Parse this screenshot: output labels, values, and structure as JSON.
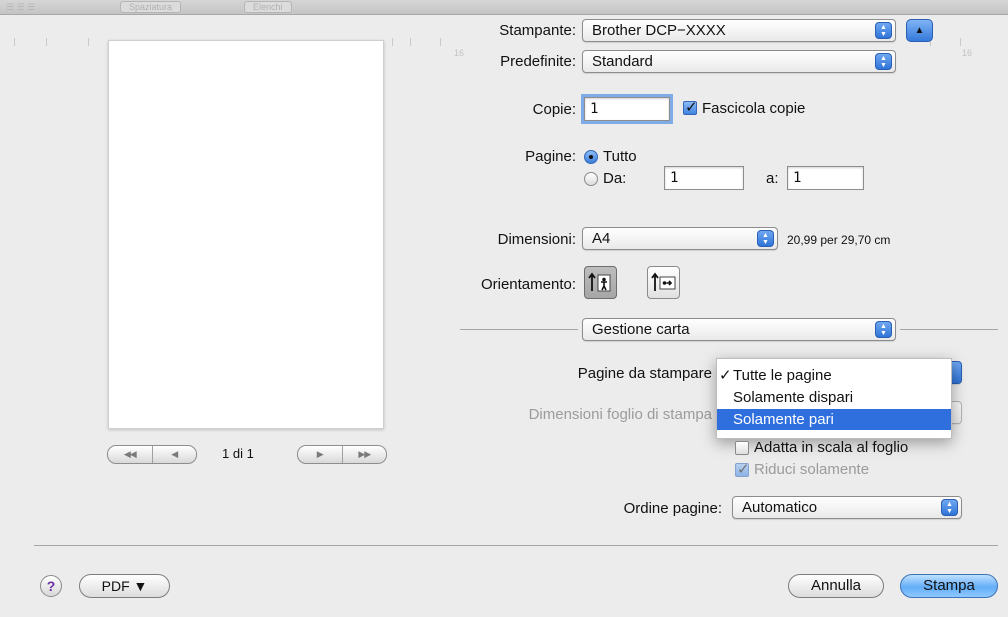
{
  "background_toolbar": {
    "left_label": "Spaziatura",
    "right_label": "Elenchi"
  },
  "preview": {
    "page_counter": "1 di 1"
  },
  "printer": {
    "label": "Stampante:",
    "value": "Brother DCP−XXXX"
  },
  "presets": {
    "label": "Predefinite:",
    "value": "Standard"
  },
  "copies": {
    "label": "Copie:",
    "value": "1",
    "collate_label": "Fascicola copie",
    "collate_checked": true
  },
  "pages": {
    "label": "Pagine:",
    "all_label": "Tutto",
    "from_label": "Da:",
    "from_value": "1",
    "to_label": "a:",
    "to_value": "1",
    "selected": "all"
  },
  "paper_size": {
    "label": "Dimensioni:",
    "value": "A4",
    "dimensions_text": "20,99 per 29,70 cm"
  },
  "orientation": {
    "label": "Orientamento:",
    "selected": "portrait"
  },
  "section_popup": {
    "value": "Gestione carta"
  },
  "pages_to_print": {
    "label": "Pagine da stampare",
    "menu_items": [
      {
        "label": "Tutte le pagine",
        "checked": true,
        "highlighted": false
      },
      {
        "label": "Solamente dispari",
        "checked": false,
        "highlighted": false
      },
      {
        "label": "Solamente pari",
        "checked": false,
        "highlighted": true
      }
    ]
  },
  "destination_paper": {
    "label": "Dimensioni foglio di stampa",
    "scale_to_fit_label": "Adatta in scala al foglio",
    "scale_down_only_label": "Riduci solamente"
  },
  "page_order": {
    "label": "Ordine pagine:",
    "value": "Automatico"
  },
  "footer": {
    "help_symbol": "?",
    "pdf_label": "PDF ▼",
    "cancel_label": "Annulla",
    "print_label": "Stampa"
  },
  "colors": {
    "accent": "#2f6edd",
    "default_button": "#63aef7",
    "window_bg": "#ececec"
  },
  "icons": [
    "stepper-arrows-icon",
    "disclosure-triangle-icon",
    "checkmark-icon",
    "portrait-orientation-icon",
    "landscape-orientation-icon",
    "help-icon",
    "nav-arrows-icon"
  ]
}
